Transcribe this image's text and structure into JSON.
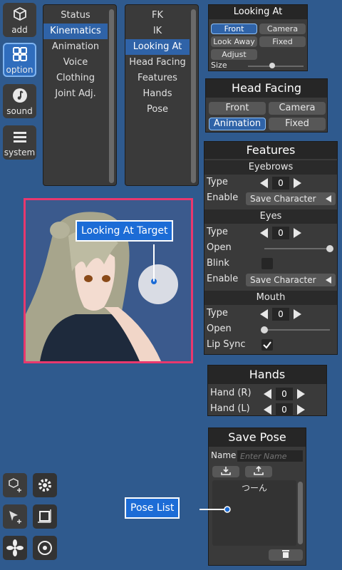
{
  "toolbar": {
    "add": "add",
    "option": "option",
    "sound": "sound",
    "system": "system"
  },
  "menu1": {
    "items": [
      "Status",
      "Kinematics",
      "Animation",
      "Voice",
      "Clothing",
      "Joint Adj."
    ],
    "selected": "Kinematics"
  },
  "menu2": {
    "items": [
      "FK",
      "IK",
      "Looking At",
      "Head Facing",
      "Features",
      "Hands",
      "Pose"
    ],
    "selected": "Looking At"
  },
  "looking_at": {
    "title": "Looking At",
    "buttons": [
      "Front",
      "Camera",
      "Look Away",
      "Fixed",
      "Adjust"
    ],
    "selected": "Front",
    "size_label": "Size",
    "size_value": 0.45
  },
  "head_facing": {
    "title": "Head Facing",
    "buttons": [
      "Front",
      "Camera",
      "Animation",
      "Fixed"
    ],
    "selected": "Animation"
  },
  "features": {
    "title": "Features",
    "eyebrows": {
      "heading": "Eyebrows",
      "type_label": "Type",
      "type_value": "0",
      "enable_label": "Enable",
      "enable_value": "Save Character"
    },
    "eyes": {
      "heading": "Eyes",
      "type_label": "Type",
      "type_value": "0",
      "open_label": "Open",
      "open_value": 1.0,
      "blink_label": "Blink",
      "blink_checked": false,
      "enable_label": "Enable",
      "enable_value": "Save Character"
    },
    "mouth": {
      "heading": "Mouth",
      "type_label": "Type",
      "type_value": "0",
      "open_label": "Open",
      "open_value": 0.0,
      "lipsync_label": "Lip Sync",
      "lipsync_checked": true
    }
  },
  "hands": {
    "title": "Hands",
    "right_label": "Hand (R)",
    "right_value": "0",
    "left_label": "Hand (L)",
    "left_value": "0"
  },
  "save_pose": {
    "title": "Save Pose",
    "name_label": "Name",
    "name_placeholder": "Enter Name",
    "list": [
      "つーん"
    ]
  },
  "callouts": {
    "looking_target": "Looking At Target",
    "pose_list": "Pose List"
  },
  "colors": {
    "background": "#2f5a8e",
    "accent": "#2f63a8",
    "highlight_border": "#e8386e",
    "callout": "#1c6cd6"
  }
}
